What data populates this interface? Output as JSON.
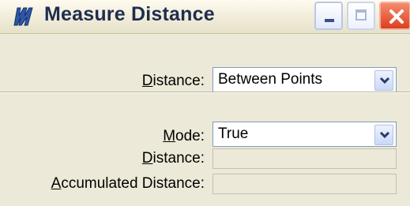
{
  "window": {
    "title": "Measure Distance",
    "icon": "measure-distance-app-icon",
    "buttons": [
      "minimize-icon",
      "maximize-icon",
      "close-icon"
    ]
  },
  "distance_method": {
    "label_key": "D",
    "label_rest": "istance:",
    "value": "Between Points"
  },
  "mode": {
    "label_key": "M",
    "label_rest": "ode:",
    "value": "True"
  },
  "distance_output": {
    "label_key": "D",
    "label_rest": "istance:",
    "value": ""
  },
  "accumulated_output": {
    "label_key": "A",
    "label_rest": "ccumulated Distance:",
    "value": ""
  }
}
